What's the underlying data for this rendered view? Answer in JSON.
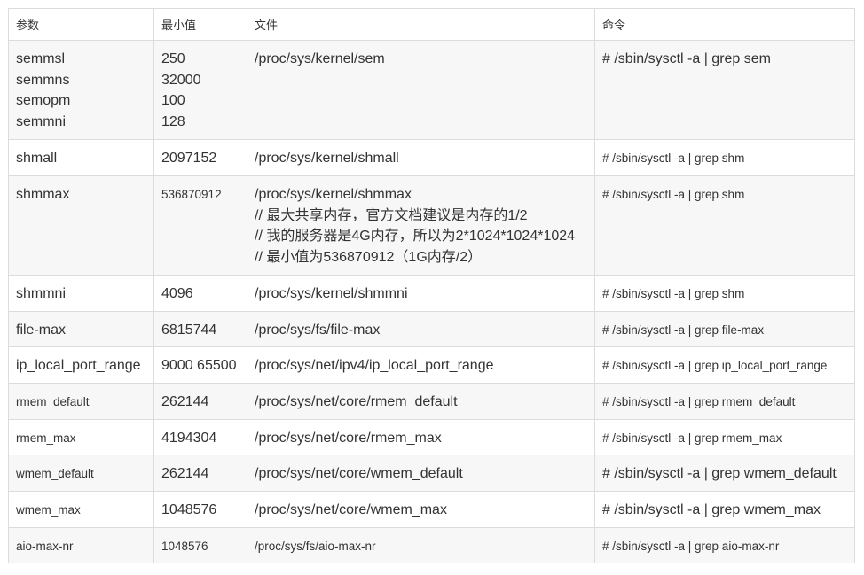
{
  "headers": [
    "参数",
    "最小值",
    "文件",
    "命令"
  ],
  "rows": [
    {
      "param": [
        "semmsl",
        "semmns",
        "semopm",
        "semmni"
      ],
      "min": [
        "250",
        "32000",
        "100",
        "128"
      ],
      "file": [
        "/proc/sys/kernel/sem"
      ],
      "cmd": "# /sbin/sysctl -a | grep sem"
    },
    {
      "param": [
        "shmall"
      ],
      "min": [
        "2097152"
      ],
      "file": [
        "/proc/sys/kernel/shmall"
      ],
      "cmd": "# /sbin/sysctl -a | grep shm"
    },
    {
      "param": [
        "shmmax"
      ],
      "min": [
        "536870912"
      ],
      "file": [
        "/proc/sys/kernel/shmmax",
        "// 最大共享内存，官方文档建议是内存的1/2",
        "// 我的服务器是4G内存，所以为2*1024*1024*1024",
        "// 最小值为536870912（1G内存/2）"
      ],
      "cmd": "# /sbin/sysctl -a | grep shm"
    },
    {
      "param": [
        "shmmni"
      ],
      "min": [
        "4096"
      ],
      "file": [
        "/proc/sys/kernel/shmmni"
      ],
      "cmd": "# /sbin/sysctl -a | grep shm"
    },
    {
      "param": [
        "file-max"
      ],
      "min": [
        "6815744"
      ],
      "file": [
        "/proc/sys/fs/file-max"
      ],
      "cmd": "# /sbin/sysctl -a | grep file-max"
    },
    {
      "param": [
        "ip_local_port_range"
      ],
      "min": [
        "9000 65500"
      ],
      "file": [
        "/proc/sys/net/ipv4/ip_local_port_range"
      ],
      "cmd": "# /sbin/sysctl -a | grep ip_local_port_range"
    },
    {
      "param": [
        "rmem_default"
      ],
      "min": [
        "262144"
      ],
      "file": [
        "/proc/sys/net/core/rmem_default"
      ],
      "cmd": "# /sbin/sysctl -a | grep rmem_default"
    },
    {
      "param": [
        "rmem_max"
      ],
      "min": [
        "4194304"
      ],
      "file": [
        "/proc/sys/net/core/rmem_max"
      ],
      "cmd": "# /sbin/sysctl -a | grep rmem_max"
    },
    {
      "param": [
        "wmem_default"
      ],
      "min": [
        "262144"
      ],
      "file": [
        "/proc/sys/net/core/wmem_default"
      ],
      "cmd": "# /sbin/sysctl -a | grep wmem_default"
    },
    {
      "param": [
        "wmem_max"
      ],
      "min": [
        "1048576"
      ],
      "file": [
        "/proc/sys/net/core/wmem_max"
      ],
      "cmd": "# /sbin/sysctl -a | grep wmem_max"
    },
    {
      "param": [
        "aio-max-nr"
      ],
      "min": [
        "1048576"
      ],
      "file": [
        "/proc/sys/fs/aio-max-nr"
      ],
      "cmd": "# /sbin/sysctl -a | grep aio-max-nr"
    }
  ]
}
